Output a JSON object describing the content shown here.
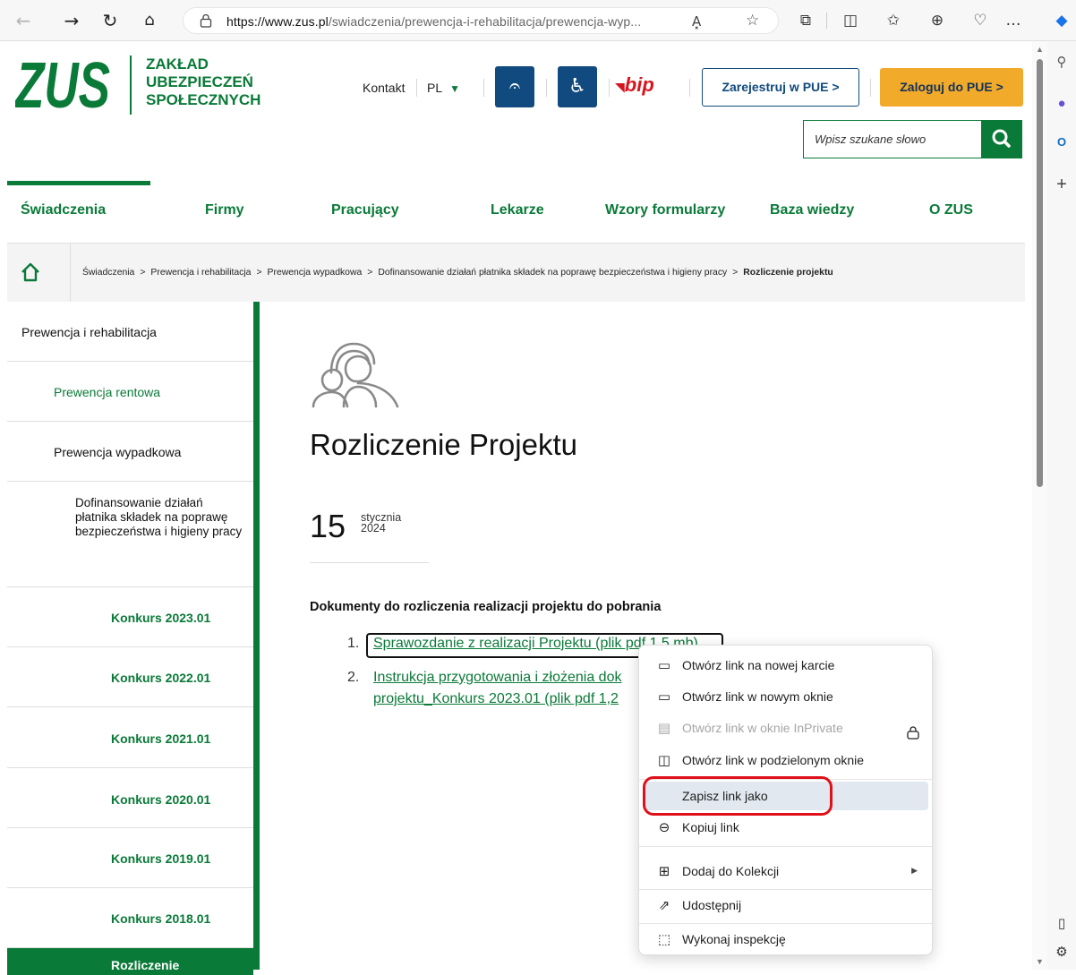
{
  "browser": {
    "url_host": "https://www.zus.pl",
    "url_path": "/swiadczenia/prewencja-i-rehabilitacja/prewencja-wyp...",
    "read_aloud": "A͓"
  },
  "header": {
    "logo_letters": "ZUS",
    "logo_text": [
      "ZAKŁAD",
      "UBEZPIECZEŃ",
      "SPOŁECZNYCH"
    ],
    "kontakt": "Kontakt",
    "lang": "PL",
    "bip": "bip",
    "register": "Zarejestruj w PUE  >",
    "login": "Zaloguj do PUE  >",
    "search_placeholder": "Wpisz szukane słowo"
  },
  "nav": [
    "Świadczenia",
    "Firmy",
    "Pracujący",
    "Lekarze",
    "Wzory formularzy",
    "Baza wiedzy",
    "O ZUS"
  ],
  "breadcrumb": {
    "items": [
      "Świadczenia",
      "Prewencja i rehabilitacja",
      "Prewencja wypadkowa",
      "Dofinansowanie działań płatnika składek na poprawę bezpieczeństwa i higieny pracy"
    ],
    "current": "Rozliczenie projektu",
    "separator": ">"
  },
  "sidebar": {
    "root": "Prewencja i rehabilitacja",
    "rentowa": "Prewencja rentowa",
    "wypadkowa": "Prewencja wypadkowa",
    "dofinansowanie": "Dofinansowanie działań płatnika składek na poprawę bezpieczeństwa i higieny pracy",
    "konkursy": [
      "Konkurs 2023.01",
      "Konkurs 2022.01",
      "Konkurs 2021.01",
      "Konkurs 2020.01",
      "Konkurs 2019.01",
      "Konkurs 2018.01"
    ],
    "active": "Rozliczenie"
  },
  "content": {
    "title": "Rozliczenie Projektu",
    "day": "15",
    "month": "stycznia",
    "year": "2024",
    "docs_heading": "Dokumenty do rozliczenia realizacji projektu do pobrania",
    "doc1_num": "1.",
    "doc1": "Sprawozdanie z realizacji Projektu (plik pdf 1,5 mb)",
    "doc2_num": "2.",
    "doc2_line1": "Instrukcja przygotowania i złożenia dok",
    "doc2_line2": "projektu_Konkurs 2023.01 (plik pdf 1,2"
  },
  "context_menu": {
    "items": [
      {
        "icon": "new-tab-icon",
        "label": "Otwórz link na nowej karcie"
      },
      {
        "icon": "new-window-icon",
        "label": "Otwórz link w nowym oknie"
      },
      {
        "icon": "inprivate-icon",
        "label": "Otwórz link w oknie InPrivate"
      },
      {
        "icon": "split-window-icon",
        "label": "Otwórz link w podzielonym oknie"
      },
      {
        "icon": "",
        "label": "Zapisz link jako"
      },
      {
        "icon": "link-icon",
        "label": "Kopiuj link"
      },
      {
        "icon": "collections-icon",
        "label": "Dodaj do Kolekcji"
      },
      {
        "icon": "share-icon",
        "label": "Udostępnij"
      },
      {
        "icon": "inspect-icon",
        "label": "Wykonaj inspekcję"
      }
    ]
  },
  "colors": {
    "zus_green": "#0a7a38",
    "zus_blue": "#104a7e",
    "zus_orange": "#f2aa2a",
    "highlight_red": "#e0101a",
    "bip_red": "#d6161e"
  }
}
